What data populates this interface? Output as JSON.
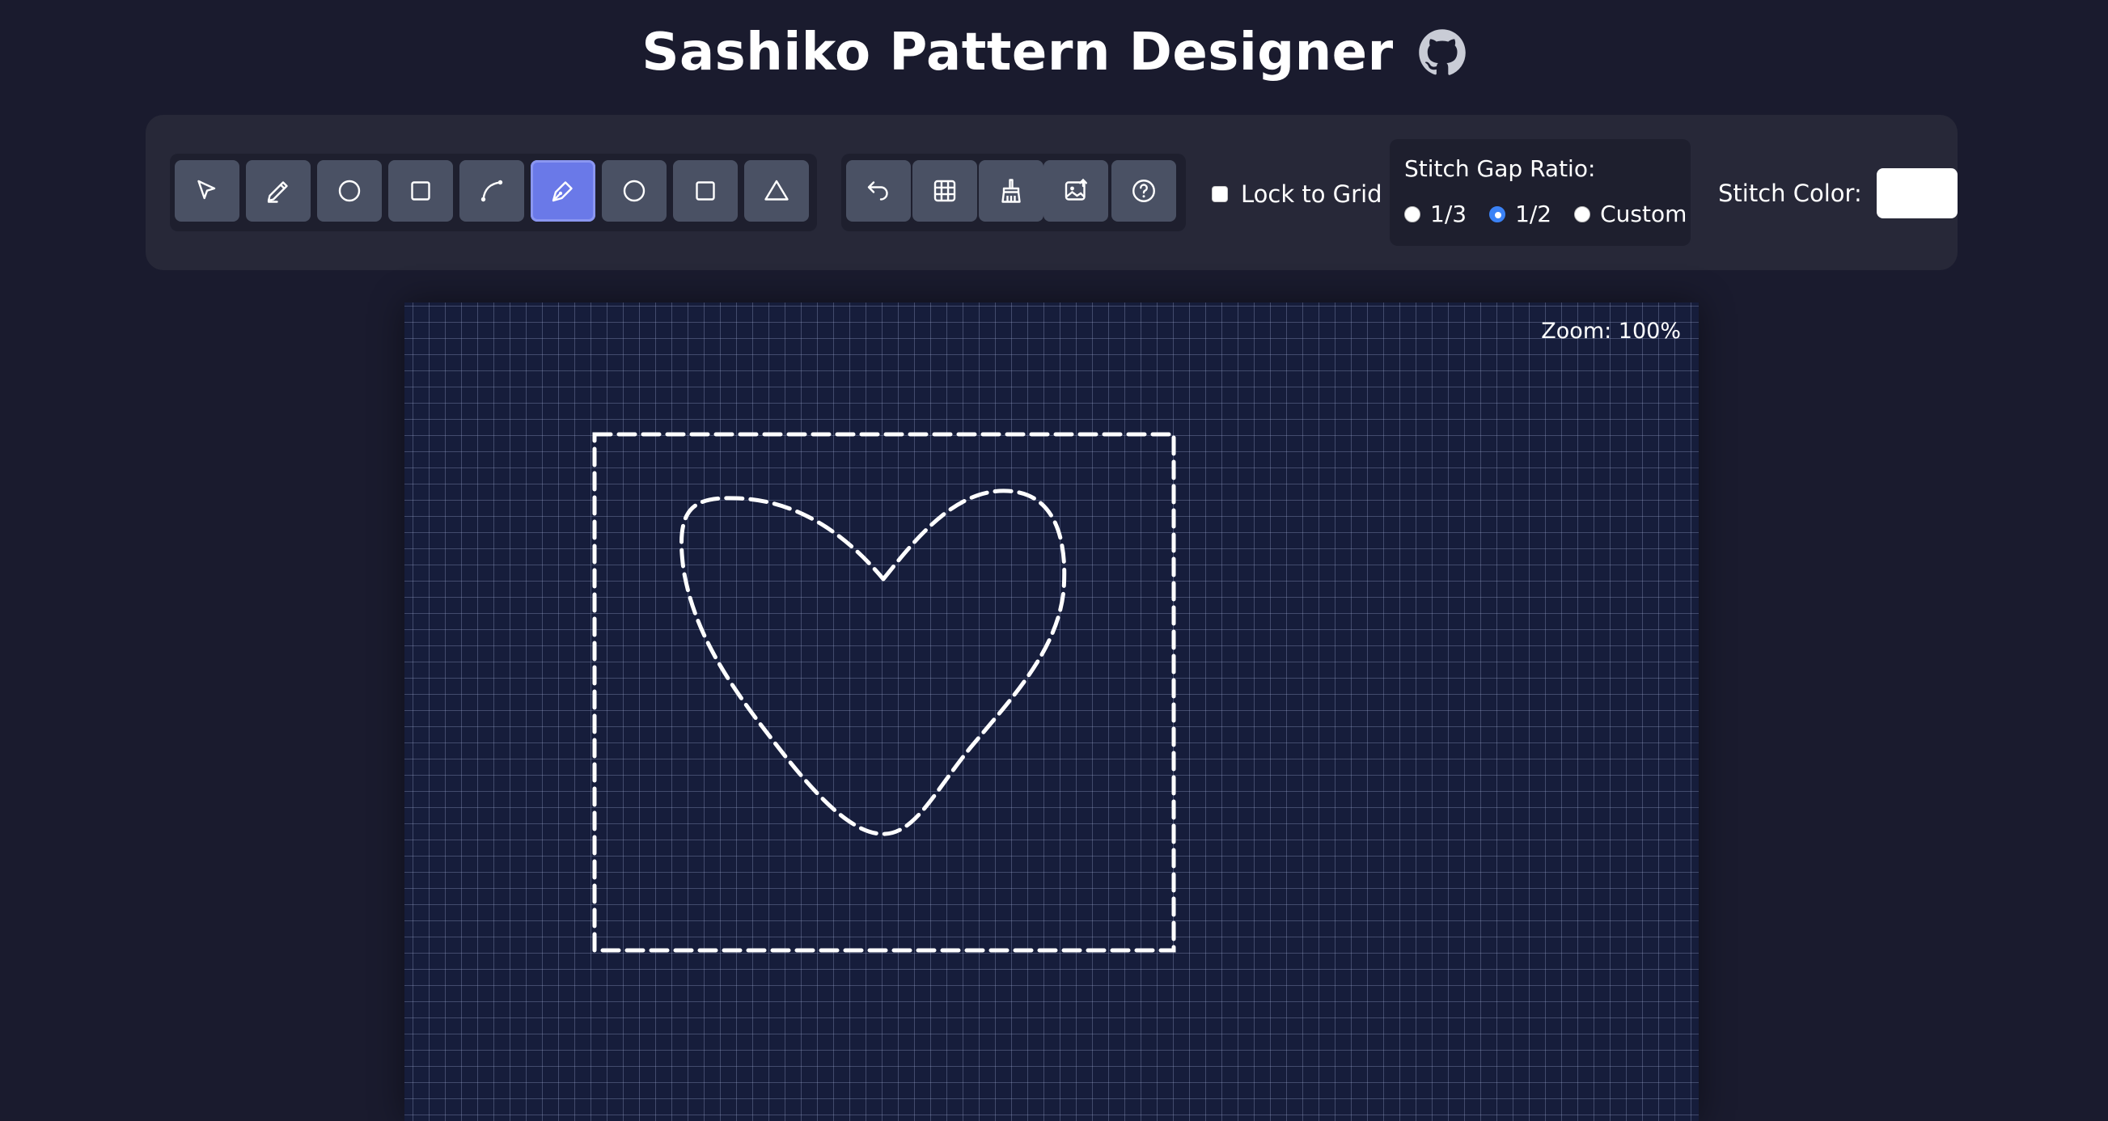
{
  "app": {
    "title": "Sashiko Pattern Designer",
    "github_icon": "github-icon"
  },
  "toolbar": {
    "draw_tools": [
      {
        "name": "select",
        "icon": "cursor-icon",
        "active": false
      },
      {
        "name": "freehand",
        "icon": "pencil-icon",
        "active": false
      },
      {
        "name": "circle",
        "icon": "circle-icon",
        "active": false
      },
      {
        "name": "square",
        "icon": "square-icon",
        "active": false
      },
      {
        "name": "curve",
        "icon": "curve-icon",
        "active": false
      },
      {
        "name": "pen",
        "icon": "pen-icon",
        "active": true
      },
      {
        "name": "circle-shape",
        "icon": "circle-icon",
        "active": false
      },
      {
        "name": "square-shape",
        "icon": "square-icon",
        "active": false
      },
      {
        "name": "triangle",
        "icon": "triangle-icon",
        "active": false
      }
    ],
    "action_tools": [
      {
        "name": "undo",
        "icon": "undo-icon"
      },
      {
        "name": "grid",
        "icon": "grid-icon"
      },
      {
        "name": "clear",
        "icon": "broom-icon"
      },
      {
        "name": "export-image",
        "icon": "image-export-icon"
      },
      {
        "name": "help",
        "icon": "help-icon"
      }
    ],
    "lock_to_grid": {
      "label": "Lock to Grid",
      "checked": false
    },
    "stitch_gap": {
      "label": "Stitch Gap Ratio:",
      "options": [
        "1/3",
        "1/2",
        "Custom"
      ],
      "selected": "1/2"
    },
    "stitch_color": {
      "label": "Stitch Color:",
      "value": "#ffffff"
    }
  },
  "canvas": {
    "zoom_label": "Zoom: 100%",
    "background": "#161d3b",
    "grid_color": "#a0aad2",
    "stitch_color": "#ffffff",
    "shapes": [
      "rectangle",
      "heart"
    ]
  }
}
